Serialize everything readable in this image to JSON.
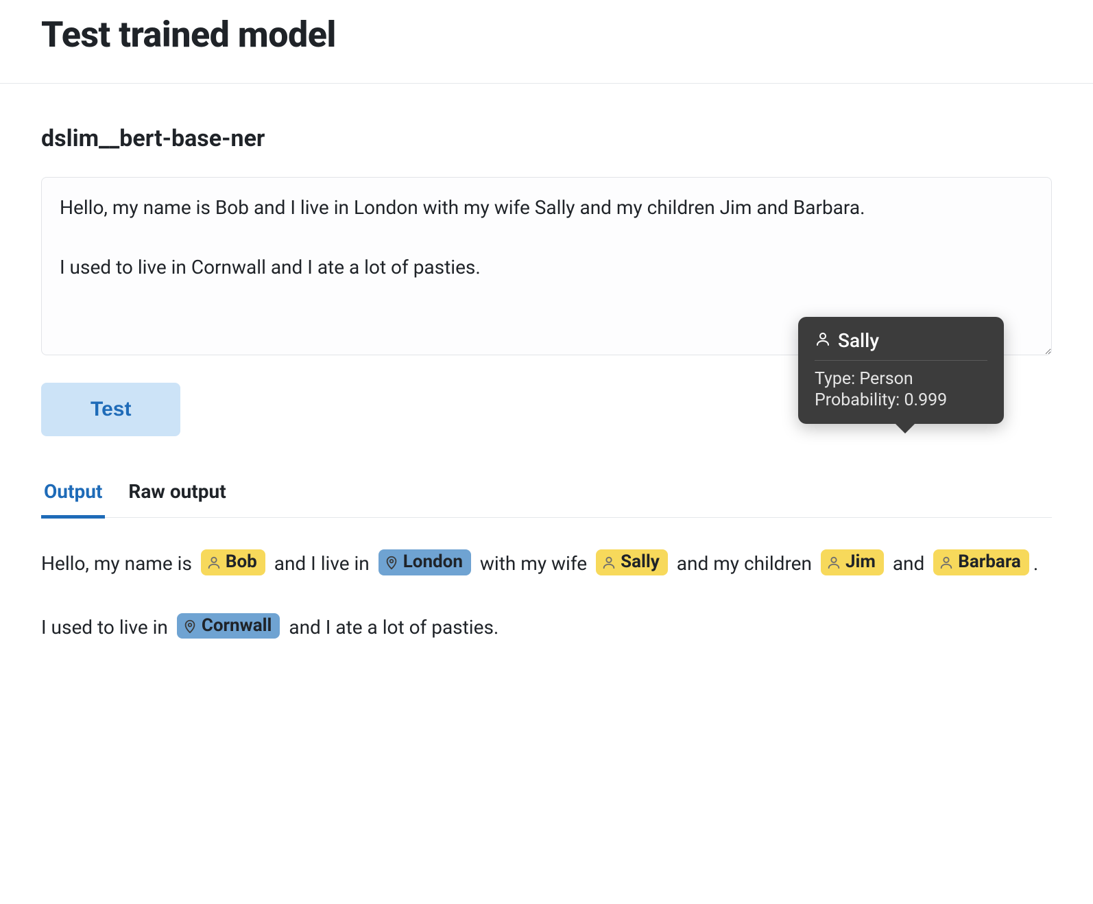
{
  "page_title": "Test trained model",
  "model_name": "dslim__bert-base-ner",
  "input_text": "Hello, my name is Bob and I live in London with my wife Sally and my children Jim and Barbara.\n\nI used to live in Cornwall and I ate a lot of pasties.",
  "test_button_label": "Test",
  "tabs": [
    {
      "label": "Output",
      "active": true
    },
    {
      "label": "Raw output",
      "active": false
    }
  ],
  "output_paragraphs": [
    [
      {
        "type": "text",
        "text": "Hello, my name is "
      },
      {
        "type": "entity",
        "entity_kind": "person",
        "icon": "user-icon",
        "text": "Bob"
      },
      {
        "type": "text",
        "text": " and I live in "
      },
      {
        "type": "entity",
        "entity_kind": "location",
        "icon": "map-pin-icon",
        "text": "London"
      },
      {
        "type": "text",
        "text": " with my wife "
      },
      {
        "type": "entity",
        "entity_kind": "person",
        "icon": "user-icon",
        "text": "Sally"
      },
      {
        "type": "text",
        "text": " and my children "
      },
      {
        "type": "entity",
        "entity_kind": "person",
        "icon": "user-icon",
        "text": "Jim"
      },
      {
        "type": "text",
        "text": " and "
      },
      {
        "type": "entity",
        "entity_kind": "person",
        "icon": "user-icon",
        "text": "Barbara"
      },
      {
        "type": "text",
        "text": "."
      }
    ],
    [
      {
        "type": "text",
        "text": "I used to live in "
      },
      {
        "type": "entity",
        "entity_kind": "location",
        "icon": "map-pin-icon",
        "text": "Cornwall"
      },
      {
        "type": "text",
        "text": " and I ate a lot of pasties."
      }
    ]
  ],
  "tooltip": {
    "icon": "user-icon",
    "title": "Sally",
    "type_label": "Type: ",
    "type_value": "Person",
    "probability_label": "Probability: ",
    "probability_value": "0.999"
  }
}
